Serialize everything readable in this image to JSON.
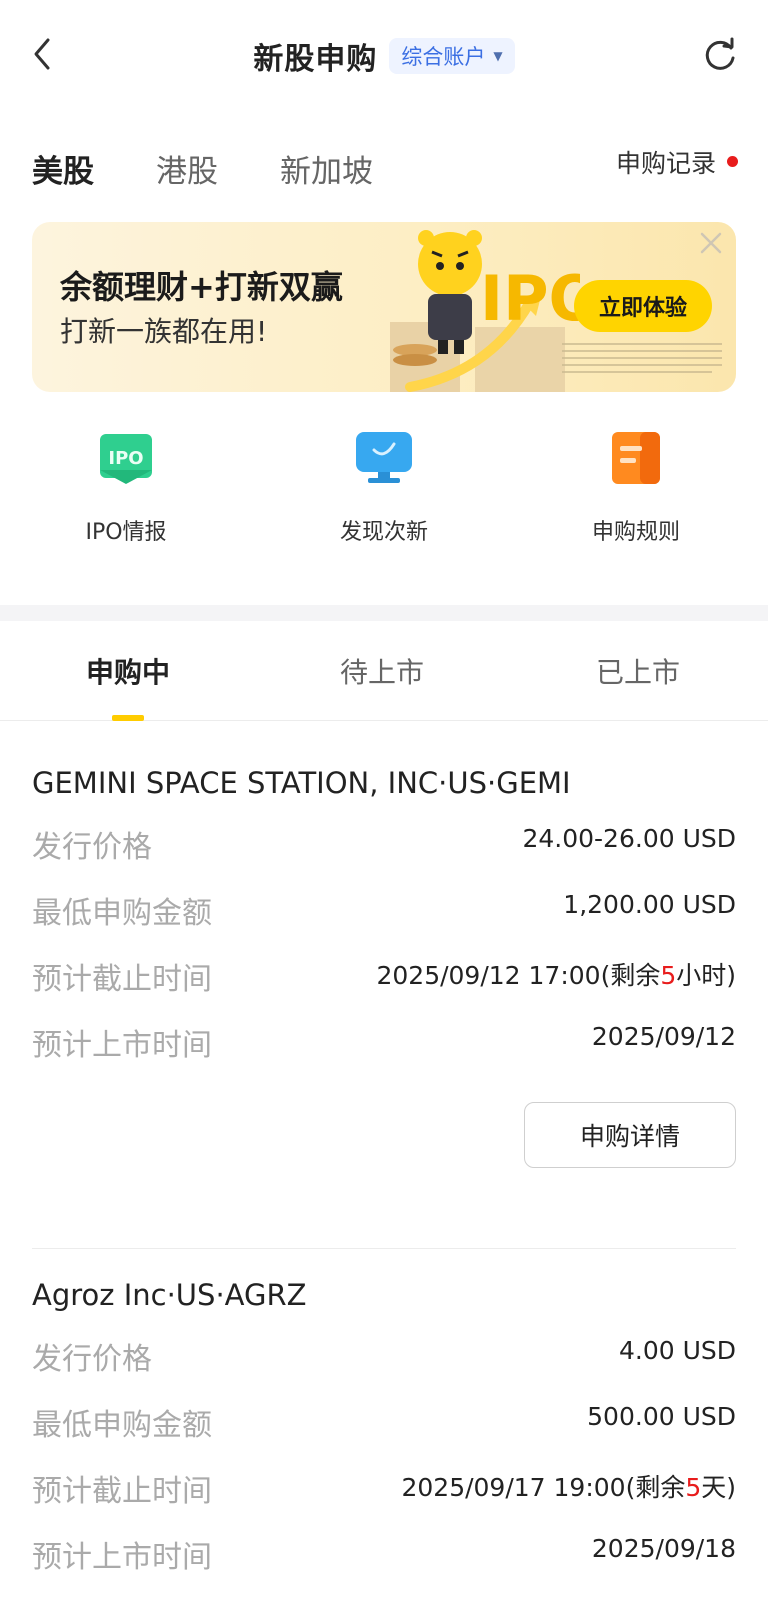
{
  "header": {
    "title": "新股申购",
    "account": "综合账户"
  },
  "market_tabs": [
    {
      "label": "美股",
      "active": true
    },
    {
      "label": "港股",
      "active": false
    },
    {
      "label": "新加坡",
      "active": false
    }
  ],
  "records_label": "申购记录",
  "banner": {
    "title": "余额理财+打新双赢",
    "subtitle": "打新一族都在用!",
    "cta": "立即体验",
    "art_text": "IPO"
  },
  "quick_entries": [
    {
      "label": "IPO情报",
      "icon": "ipo-icon",
      "icon_text": "IPO",
      "color": "#2fcf8f"
    },
    {
      "label": "发现次新",
      "icon": "monitor-icon",
      "color": "#37a8f0"
    },
    {
      "label": "申购规则",
      "icon": "document-icon",
      "color": "#ff8a1f"
    }
  ],
  "status_tabs": [
    {
      "label": "申购中",
      "active": true
    },
    {
      "label": "待上市",
      "active": false
    },
    {
      "label": "已上市",
      "active": false
    }
  ],
  "ipos": [
    {
      "name": "GEMINI SPACE STATION, INC·US·GEMI",
      "rows": [
        {
          "label": "发行价格",
          "value": "24.00-26.00 USD"
        },
        {
          "label": "最低申购金额",
          "value": "1,200.00 USD"
        },
        {
          "label": "预计截止时间",
          "value_pre": "2025/09/12 17:00(剩余",
          "value_hl": "5",
          "value_post": "小时)"
        },
        {
          "label": "预计上市时间",
          "value": "2025/09/12"
        }
      ],
      "button": "申购详情"
    },
    {
      "name": "Agroz Inc·US·AGRZ",
      "rows": [
        {
          "label": "发行价格",
          "value": "4.00 USD"
        },
        {
          "label": "最低申购金额",
          "value": "500.00 USD"
        },
        {
          "label": "预计截止时间",
          "value_pre": "2025/09/17 19:00(剩余",
          "value_hl": "5",
          "value_post": "天)"
        },
        {
          "label": "预计上市时间",
          "value": "2025/09/18"
        }
      ]
    }
  ],
  "colors": {
    "accent_yellow": "#ffcc00",
    "highlight_red": "#e81c1c",
    "link_blue": "#3b6fe3"
  }
}
